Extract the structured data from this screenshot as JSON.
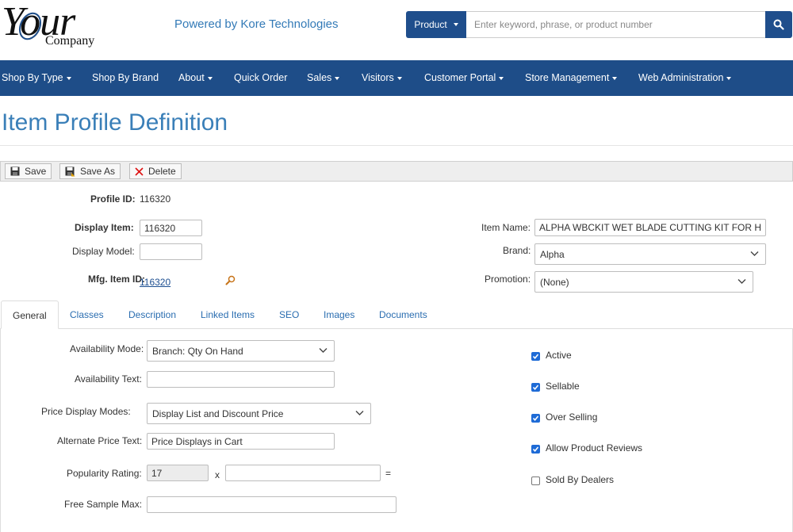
{
  "header": {
    "logo_main": "Your",
    "logo_sub": "Company",
    "powered_by": "Powered by Kore Technologies",
    "search": {
      "dropdown_label": "Product",
      "placeholder": "Enter keyword, phrase, or product number"
    }
  },
  "nav": {
    "items": [
      {
        "label": "Shop By Type"
      },
      {
        "label": "Shop By Brand"
      },
      {
        "label": "About"
      },
      {
        "label": "Quick Order"
      },
      {
        "label": "Sales"
      },
      {
        "label": "Visitors"
      },
      {
        "label": "Customer Portal"
      },
      {
        "label": "Store Management"
      },
      {
        "label": "Web Administration"
      }
    ]
  },
  "page": {
    "title": "Item Profile Definition"
  },
  "toolbar": {
    "save_label": "Save",
    "save_as_label": "Save As",
    "delete_label": "Delete"
  },
  "profile": {
    "profile_id_label": "Profile ID:",
    "profile_id_value": "116320",
    "display_item_label": "Display Item:",
    "display_item_value": "116320",
    "display_model_label": "Display Model:",
    "display_model_value": "",
    "mfg_item_id_label": "Mfg. Item ID:",
    "mfg_item_id_value": "116320",
    "item_name_label": "Item Name:",
    "item_name_value": "ALPHA WBCKIT WET BLADE CUTTING KIT FOR H",
    "brand_label": "Brand:",
    "brand_value": "Alpha",
    "promotion_label": "Promotion:",
    "promotion_value": "(None)"
  },
  "tabs": [
    {
      "label": "General"
    },
    {
      "label": "Classes"
    },
    {
      "label": "Description"
    },
    {
      "label": "Linked Items"
    },
    {
      "label": "SEO"
    },
    {
      "label": "Images"
    },
    {
      "label": "Documents"
    }
  ],
  "general": {
    "availability_mode_label": "Availability Mode:",
    "availability_mode_value": "Branch: Qty On Hand",
    "availability_text_label": "Availability Text:",
    "availability_text_value": "",
    "price_display_modes_label": "Price Display Modes:",
    "price_display_modes_value": "Display List and Discount Price",
    "alternate_price_text_label": "Alternate Price Text:",
    "alternate_price_text_value": "Price Displays in Cart",
    "popularity_rating_label": "Popularity Rating:",
    "popularity_rating_value": "17",
    "popularity_multiplier_symbol": "x",
    "popularity_multiplier_value": "",
    "popularity_equals_symbol": "=",
    "free_sample_max_label": "Free Sample Max:",
    "free_sample_max_value": ""
  },
  "flags": [
    {
      "label": "Active",
      "checked": true
    },
    {
      "label": "Sellable",
      "checked": true
    },
    {
      "label": "Over Selling",
      "checked": true
    },
    {
      "label": "Allow Product Reviews",
      "checked": true
    },
    {
      "label": "Sold By Dealers",
      "checked": false
    }
  ],
  "colors": {
    "nav_bg": "#1e4d88",
    "title": "#3a7fb8",
    "link": "#2a6db0",
    "checkbox_on": "#1e6bd6"
  }
}
